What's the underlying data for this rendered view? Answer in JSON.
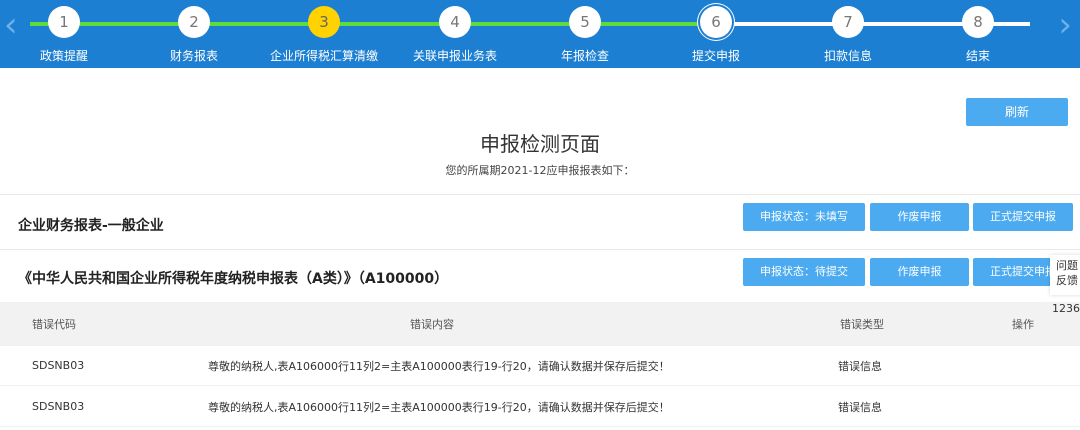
{
  "stepper": {
    "prev_icon": "chevron-left-icon",
    "next_icon": "chevron-right-icon",
    "steps": [
      {
        "number": "1",
        "label": "政策提醒"
      },
      {
        "number": "2",
        "label": "财务报表"
      },
      {
        "number": "3",
        "label": "企业所得税汇算清缴"
      },
      {
        "number": "4",
        "label": "关联申报业务表"
      },
      {
        "number": "5",
        "label": "年报检查"
      },
      {
        "number": "6",
        "label": "提交申报"
      },
      {
        "number": "7",
        "label": "扣款信息"
      },
      {
        "number": "8",
        "label": "结束"
      }
    ],
    "colors": {
      "background": "#1d7fd2",
      "completed_track": "#5ddc3c",
      "current_step": "#ffd200"
    }
  },
  "toolbar": {
    "refresh_label": "刷新"
  },
  "page": {
    "title": "申报检测页面",
    "subtitle": "您的所属期2021-12应申报报表如下："
  },
  "reports": [
    {
      "name": "企业财务报表-一般企业",
      "status_label": "申报状态：未填写",
      "void_label": "作废申报",
      "submit_label": "正式提交申报"
    },
    {
      "name": "《中华人民共和国企业所得税年度纳税申报表（A类）》（A100000）",
      "status_label": "申报状态：待提交",
      "void_label": "作废申报",
      "submit_label": "正式提交申报"
    }
  ],
  "error_table": {
    "columns": {
      "code": "错误代码",
      "content": "错误内容",
      "type": "错误类型",
      "action": "操作"
    },
    "rows": [
      {
        "code": "SDSNB03",
        "content": "尊敬的纳税人,表A106000行11列2=主表A100000表行19-行20，请确认数据并保存后提交！",
        "type": "错误信息",
        "action": ""
      },
      {
        "code": "SDSNB03",
        "content": "尊敬的纳税人,表A106000行11列2=主表A100000表行19-行20，请确认数据并保存后提交！",
        "type": "错误信息",
        "action": ""
      }
    ]
  },
  "side_widget": {
    "line1": "问题",
    "line2": "反馈",
    "phone": "1236"
  },
  "accent_color": "#4cabf0"
}
